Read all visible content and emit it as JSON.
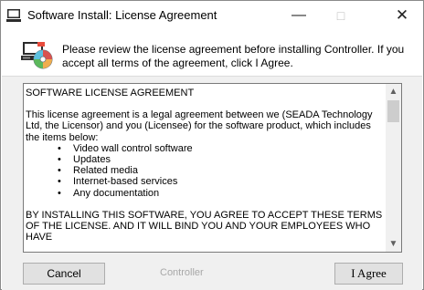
{
  "window": {
    "title": "Software Install: License Agreement",
    "controls": {
      "minimize": "—",
      "maximize": "□",
      "close": "✕"
    }
  },
  "header": {
    "message": "Please review the license agreement before installing Controller. If you accept all terms of the agreement, click I Agree.",
    "icon": "computer-disc-icon"
  },
  "license": {
    "heading": "SOFTWARE LICENSE AGREEMENT",
    "intro": "This license agreement is a legal agreement between we (SEADA Technology Ltd, the Licensor) and you (Licensee) for the software product, which includes the items below:",
    "items": [
      "Video wall control software",
      "Updates",
      "Related media",
      "Internet-based services",
      "Any documentation"
    ],
    "closing": "BY INSTALLING THIS SOFTWARE, YOU AGREE TO ACCEPT THESE TERMS OF THE LICENSE. AND IT WILL BIND YOU AND YOUR EMPLOYEES WHO HAVE"
  },
  "scrollbar": {
    "up": "▲",
    "down": "▼"
  },
  "footer": {
    "cancel_label": "Cancel",
    "brand": "Controller",
    "agree_label": "I Agree"
  },
  "colors": {
    "button_face": "#e1e1e1",
    "button_border": "#adadad",
    "body_bg": "#f0f0f0"
  }
}
